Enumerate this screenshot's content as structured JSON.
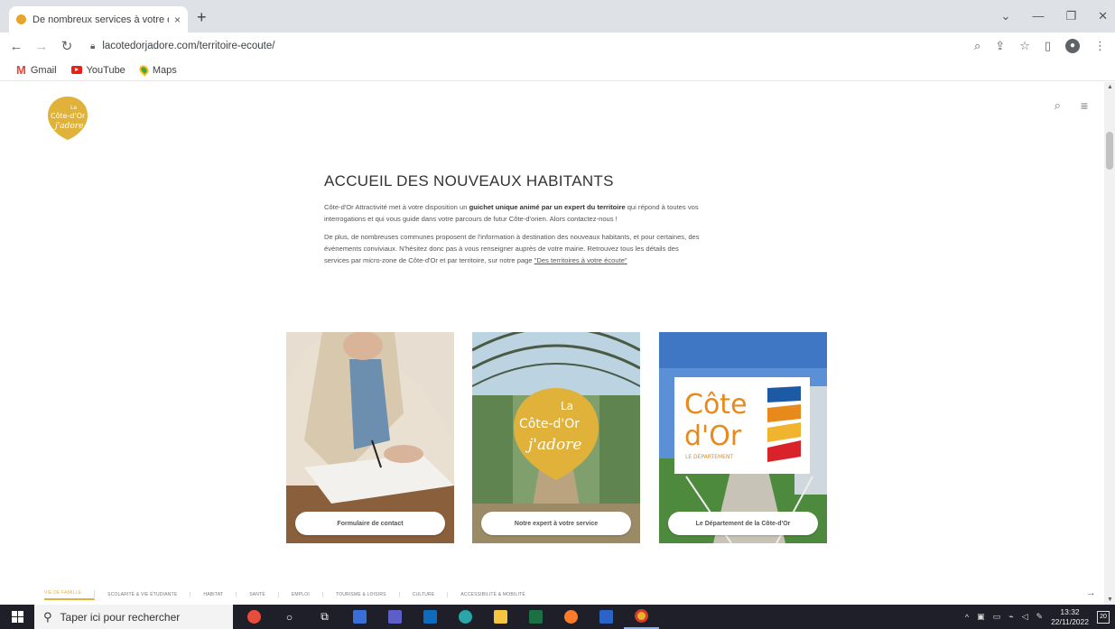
{
  "browser": {
    "tab_title": "De nombreux services à votre or",
    "tab_close": "×",
    "new_tab": "+",
    "url": "lacotedorjadore.com/territoire-ecoute/",
    "bookmarks": [
      {
        "label": "Gmail",
        "icon": "gmail-icon"
      },
      {
        "label": "YouTube",
        "icon": "youtube-icon"
      },
      {
        "label": "Maps",
        "icon": "maps-icon"
      }
    ]
  },
  "site": {
    "logo_line1": "La",
    "logo_line2": "Côte-d'Or",
    "logo_line3": "j'adore",
    "heading": "ACCUEIL DES NOUVEAUX HABITANTS",
    "para1_a": "Côte-d'Or Attractivité met à votre disposition un ",
    "para1_b": "guichet unique animé par un expert du territoire",
    "para1_c": " qui répond à toutes vos interrogations et qui vous guide dans votre parcours de futur Côte-d'orien. Alors contactez-nous !",
    "para2_a": "De plus, de nombreuses communes proposent de l'information à destination des nouveaux habitants, et pour certaines, des événements conviviaux. N'hésitez donc pas à vous renseigner auprès de votre mairie. Retrouvez tous les détails des services par micro-zone de Côte-d'Or et par territoire, sur notre page ",
    "para2_link": "\"Des territoires à votre écoute\"",
    "cards": [
      {
        "button": "Formulaire de contact"
      },
      {
        "button": "Notre expert à votre service",
        "logo_line1": "La",
        "logo_line2": "Côte-d'Or",
        "logo_line3": "j'adore"
      },
      {
        "button": "Le Département de la Côte-d'Or",
        "logo_line1": "Côte",
        "logo_line2": "d'Or",
        "logo_line3": "LE DÉPARTEMENT"
      }
    ],
    "categories": [
      "VIE DE FAMILLE",
      "SCOLARITÉ & VIE ÉTUDIANTE",
      "HABITAT",
      "SANTÉ",
      "EMPLOI",
      "TOURISME & LOISIRS",
      "CULTURE",
      "ACCESSIBILITÉ & MOBILITÉ"
    ],
    "category_arrow": "→"
  },
  "taskbar": {
    "search_placeholder": "Taper ici pour rechercher",
    "time": "13:32",
    "date": "22/11/2022",
    "notifications": "20"
  },
  "colors": {
    "brand_yellow": "#e0b23a",
    "dept_orange": "#e8891c",
    "dept_red": "#d8232a",
    "dept_blue": "#1c5aa6"
  }
}
